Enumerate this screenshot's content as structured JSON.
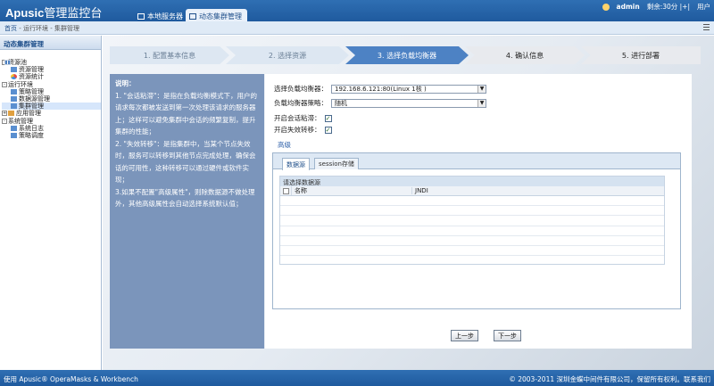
{
  "header": {
    "logo_brand": "Apusic",
    "logo_suffix": "管理监控台",
    "tabs": [
      {
        "label": "本地服务器",
        "active": false
      },
      {
        "label": "动态集群管理",
        "active": true
      }
    ],
    "user": "admin",
    "remaining": "剩余:30分 |+|",
    "user_menu": "用户"
  },
  "breadcrumb": {
    "items": [
      "首页",
      "运行环境",
      "集群管理"
    ],
    "sep": " - "
  },
  "sidebar": {
    "title": "动态集群管理",
    "nodes": [
      {
        "label": "资源池",
        "level": 0,
        "toggle": "-",
        "icon": "grid"
      },
      {
        "label": "资源管理",
        "level": 1,
        "icon": "blue"
      },
      {
        "label": "资源统计",
        "level": 1,
        "icon": "pie"
      },
      {
        "label": "运行环境",
        "level": 0,
        "toggle": "-",
        "icon": "grid"
      },
      {
        "label": "策略管理",
        "level": 1,
        "icon": "blue"
      },
      {
        "label": "数据源管理",
        "level": 1,
        "icon": "blue"
      },
      {
        "label": "集群管理",
        "level": 1,
        "icon": "blue",
        "selected": true
      },
      {
        "label": "应用管理",
        "level": 0,
        "toggle": "+",
        "icon": "orange"
      },
      {
        "label": "系统管理",
        "level": 0,
        "toggle": "-",
        "icon": "grid"
      },
      {
        "label": "系统日志",
        "level": 1,
        "icon": "blue"
      },
      {
        "label": "策略调度",
        "level": 1,
        "icon": "blue"
      }
    ]
  },
  "steps": [
    {
      "label": "1. 配置基本信息",
      "state": "done"
    },
    {
      "label": "2. 选择资源",
      "state": "done"
    },
    {
      "label": "3. 选择负载均衡器",
      "state": "active"
    },
    {
      "label": "4. 确认信息",
      "state": "todo"
    },
    {
      "label": "5. 进行部署",
      "state": "todo"
    }
  ],
  "description": {
    "title": "说明：",
    "lines": [
      "1. \"会话粘滞\"：是指在负载均衡模式下，用户的请求每次都被发送到第一次处理该请求的服务器上；这样可以避免集群中会话的频繁复制，提升集群的性能；",
      "2. \"失效转移\"：是指集群中，当某个节点失效时，服务可以转移到其他节点完成处理，确保会话的可用性，这种转移可以通过硬件或软件实现；",
      "3.如果不配置\"高级属性\"，则除数据源不做处理外，其他高级属性会自动选择系统默认值；"
    ]
  },
  "form": {
    "balancer_label": "选择负载均衡器：",
    "balancer_value": "192.168.6.121:80(Linux 1核 )",
    "policy_label": "负载均衡器策略：",
    "policy_value": "随机",
    "sticky_label": "开启会话粘滞：",
    "sticky_checked": true,
    "failover_label": "开启失效转移：",
    "failover_checked": true,
    "advanced_link": "高级"
  },
  "tabs": [
    {
      "label": "数据源",
      "active": true
    },
    {
      "label": "session存储",
      "active": false
    }
  ],
  "grid": {
    "caption": "请选择数据源",
    "columns": [
      "名称",
      "JNDI"
    ],
    "rows": []
  },
  "buttons": {
    "prev": "上一步",
    "next": "下一步"
  },
  "footer": {
    "left": "使用 Apusic® OperaMasks & Workbench",
    "right": "© 2003-2011 深圳金蝶中间件有限公司，保留所有权利。联系我们"
  },
  "colors": {
    "header_blue": "#1f5a9e",
    "active_step": "#4d82c4",
    "desc_panel": "#7b95bb"
  }
}
